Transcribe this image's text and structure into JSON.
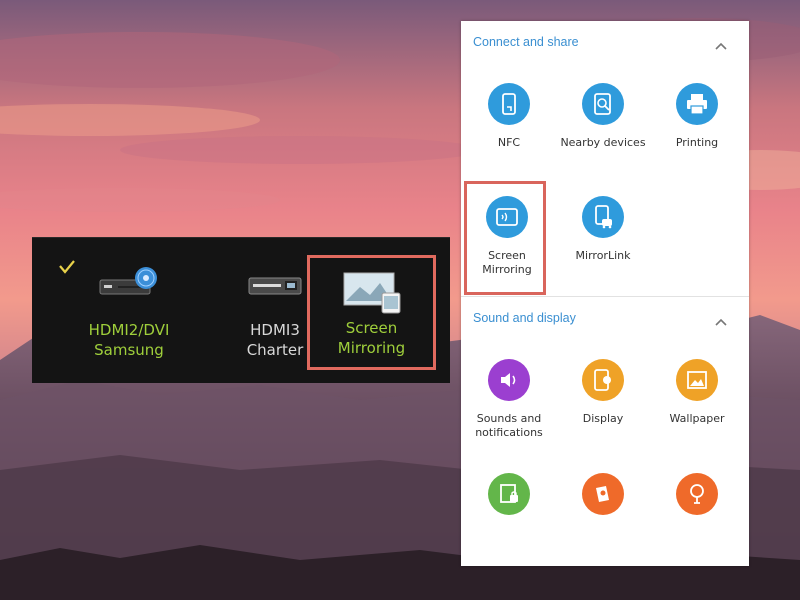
{
  "tv_sources": [
    {
      "label_lines": [
        "HDMI2/DVI",
        "Samsung"
      ],
      "selected": true
    },
    {
      "label_lines": [
        "HDMI3",
        "Charter"
      ],
      "selected": false
    },
    {
      "label_lines": [
        "Screen Mirroring"
      ],
      "selected": false
    }
  ],
  "quick_panel": {
    "sections": [
      {
        "title": "Connect and share",
        "tiles": [
          {
            "label": "NFC",
            "icon": "nfc-icon"
          },
          {
            "label": "Nearby devices",
            "icon": "nearby-devices-icon"
          },
          {
            "label": "Printing",
            "icon": "printer-icon"
          },
          {
            "label_lines": [
              "Screen",
              "Mirroring"
            ],
            "icon": "screen-mirroring-icon"
          },
          {
            "label": "MirrorLink",
            "icon": "mirrorlink-icon"
          }
        ]
      },
      {
        "title": "Sound and display",
        "tiles": [
          {
            "label_lines": [
              "Sounds and",
              "notifications"
            ],
            "icon": "speaker-icon"
          },
          {
            "label": "Display",
            "icon": "display-icon"
          },
          {
            "label": "Wallpaper",
            "icon": "wallpaper-icon"
          },
          {
            "label": "",
            "icon": "lock-screen-icon"
          },
          {
            "label": "",
            "icon": "themes-icon"
          },
          {
            "label": "",
            "icon": "accessibility-icon"
          }
        ]
      }
    ]
  },
  "colors": {
    "accent_blue": "#2f9bdc",
    "highlight_red": "#d9655c",
    "tv_selected_green": "#9fcf3b"
  }
}
